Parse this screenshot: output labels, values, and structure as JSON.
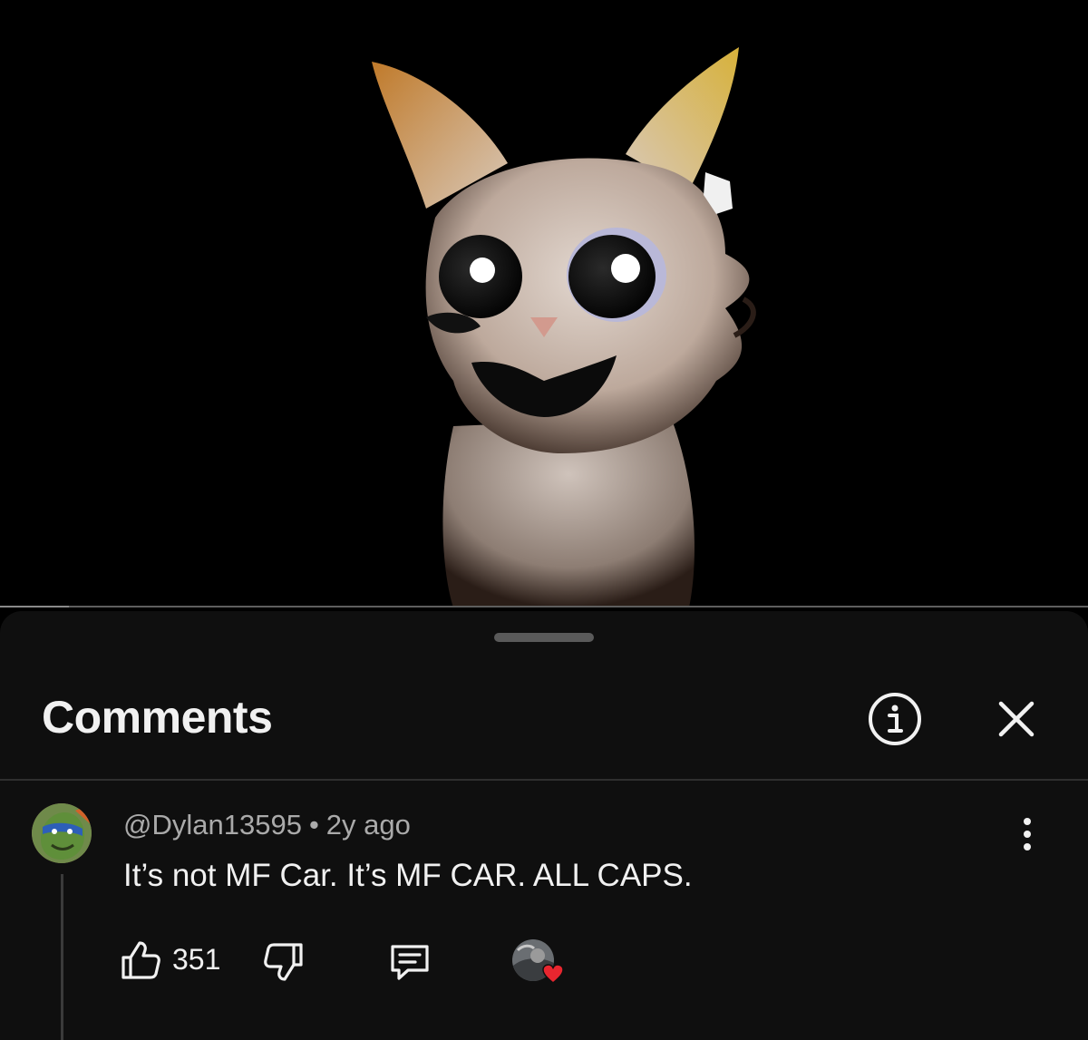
{
  "video": {
    "progress": 0.063
  },
  "comments_panel": {
    "title": "Comments",
    "info_icon": "info-circle-icon",
    "close_icon": "close-icon"
  },
  "comment": {
    "author": "@Dylan13595",
    "separator": "•",
    "time": "2y ago",
    "text": "It’s not MF Car. It’s MF CAR. ALL CAPS.",
    "likes": "351",
    "icons": {
      "like": "thumbs-up-icon",
      "dislike": "thumbs-down-icon",
      "reply": "reply-comment-icon",
      "more": "more-vertical-icon",
      "creator_heart": "heart-icon"
    },
    "colors": {
      "heart": "#e8262f"
    }
  }
}
